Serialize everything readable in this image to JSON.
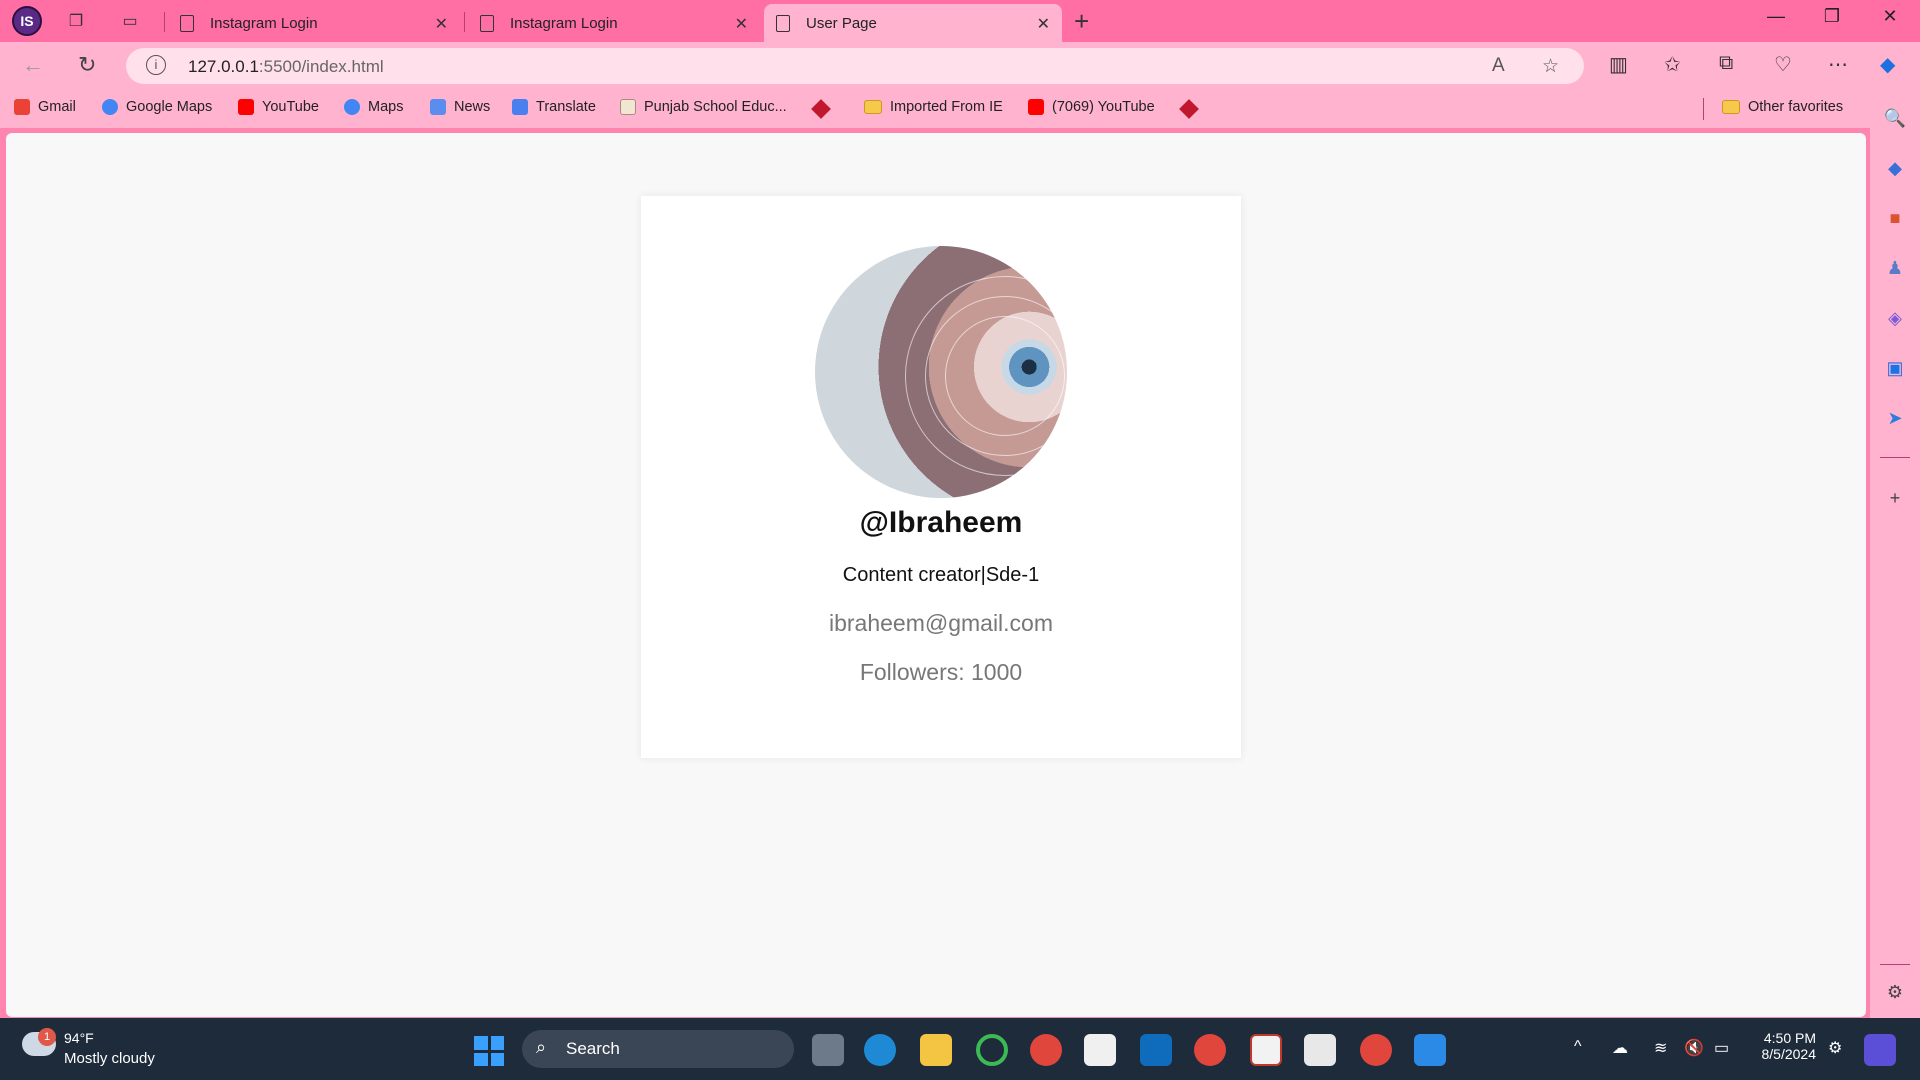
{
  "browser": {
    "profile_initials": "IS",
    "tabs": [
      {
        "title": "Instagram Login"
      },
      {
        "title": "Instagram Login"
      },
      {
        "title": "User Page"
      }
    ],
    "url_host": "127.0.0.1",
    "url_path": ":5500/index.html"
  },
  "bookmarks": [
    {
      "label": "Gmail"
    },
    {
      "label": "Google Maps"
    },
    {
      "label": "YouTube"
    },
    {
      "label": "Maps"
    },
    {
      "label": "News"
    },
    {
      "label": "Translate"
    },
    {
      "label": "Punjab School Educ..."
    },
    {
      "label": "Imported From IE"
    },
    {
      "label": "(7069) YouTube"
    }
  ],
  "other_favorites": "Other favorites",
  "profile": {
    "username": "@Ibraheem",
    "bio": "Content creator|Sde-1",
    "email": "ibraheem@gmail.com",
    "followers_label": "Followers:",
    "followers_count": "1000"
  },
  "taskbar": {
    "weather_badge": "1",
    "temperature": "94°F",
    "weather_desc": "Mostly cloudy",
    "search_label": "Search",
    "time": "4:50 PM",
    "date": "8/5/2024"
  },
  "colors": {
    "chrome": "#ff6fa3",
    "toolbar": "#ffb3cf",
    "taskbar": "#1d2b3b"
  }
}
